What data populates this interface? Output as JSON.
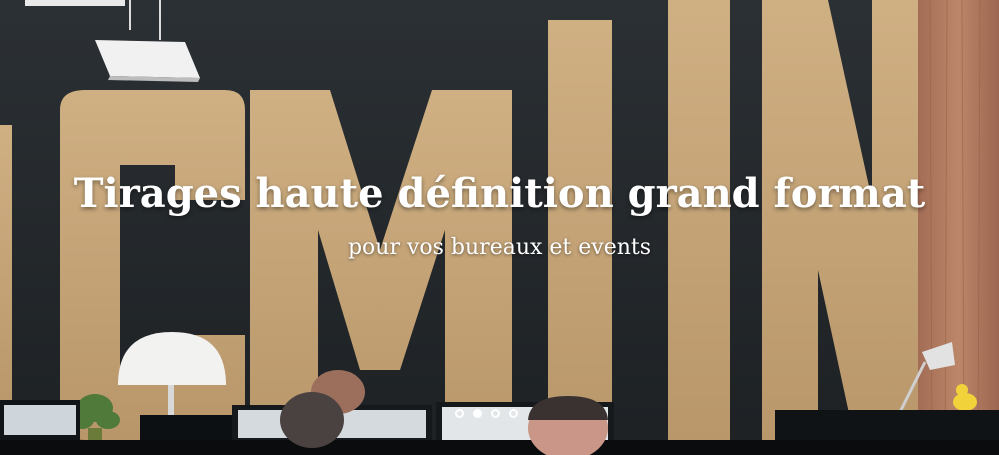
{
  "hero": {
    "title": "Tirages haute définition grand format",
    "subtitle": "pour vos bureaux et events"
  },
  "carousel": {
    "slide_count": 4,
    "active_index": 1
  },
  "colors": {
    "wall": "#23272b",
    "letters": "#c9a97a",
    "wood": "#b07a60",
    "text": "#ffffff"
  }
}
